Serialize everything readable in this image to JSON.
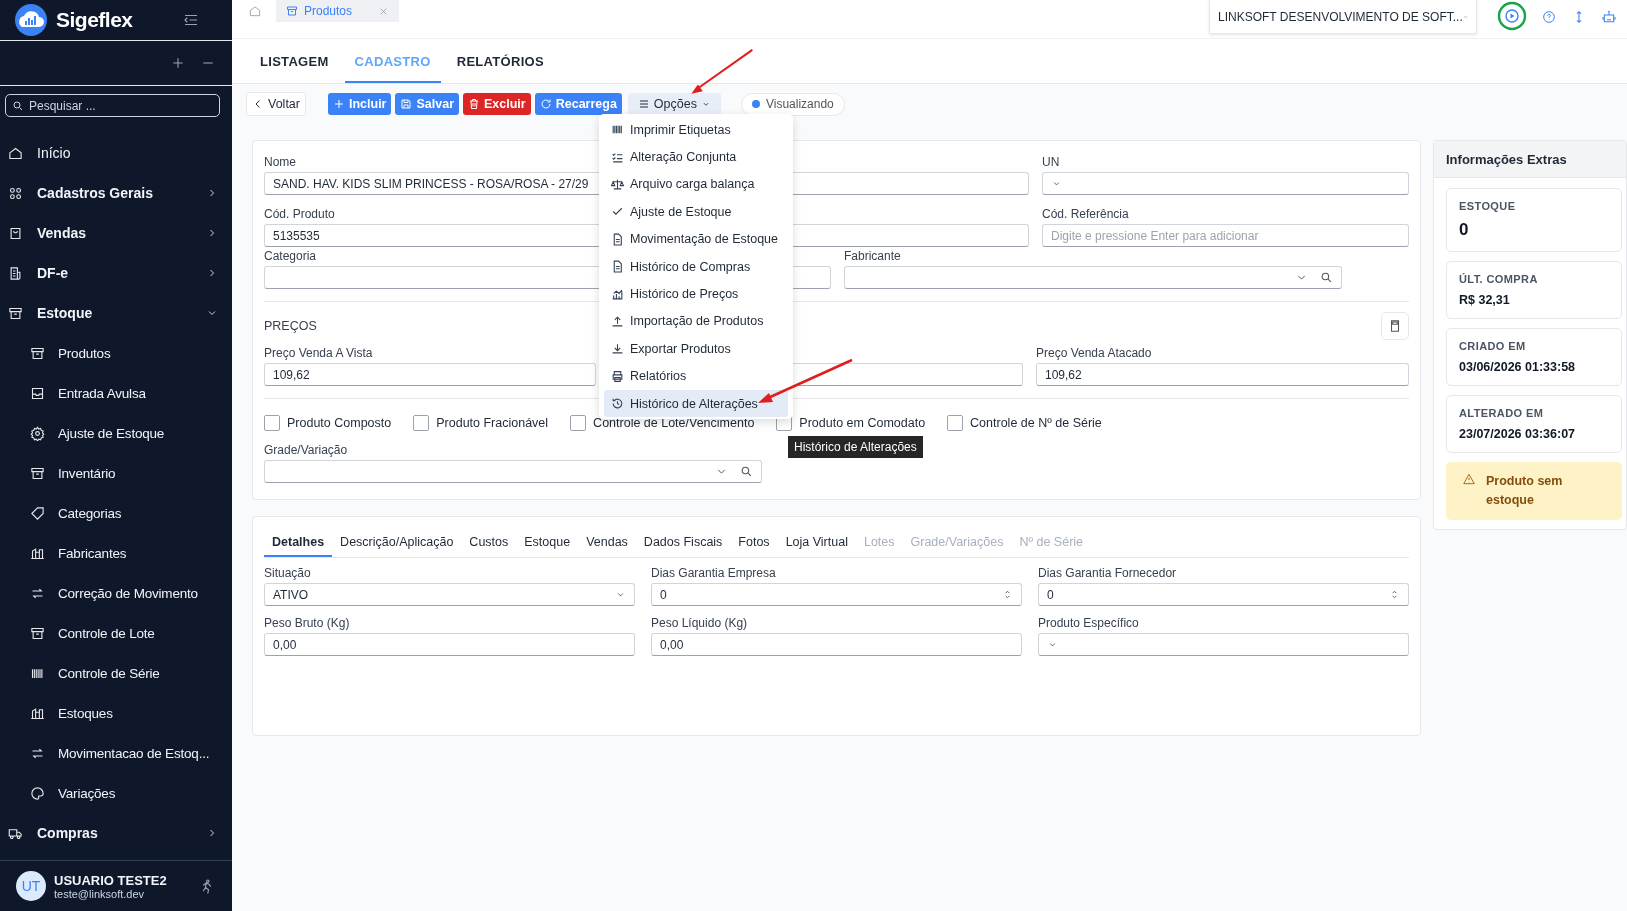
{
  "sidebar": {
    "brand": "Sigeflex",
    "search": {
      "placeholder": "Pesquisar ..."
    },
    "items": [
      {
        "label": "Início"
      },
      {
        "label": "Cadastros Gerais",
        "expanded": false
      },
      {
        "label": "Vendas",
        "expanded": false
      },
      {
        "label": "DF-e",
        "expanded": false
      },
      {
        "label": "Estoque",
        "expanded": true,
        "children": [
          {
            "label": "Produtos"
          },
          {
            "label": "Entrada Avulsa"
          },
          {
            "label": "Ajuste de Estoque"
          },
          {
            "label": "Inventário"
          },
          {
            "label": "Categorias"
          },
          {
            "label": "Fabricantes"
          },
          {
            "label": "Correção de Movimento"
          },
          {
            "label": "Controle de Lote"
          },
          {
            "label": "Controle de Série"
          },
          {
            "label": "Estoques"
          },
          {
            "label": "Movimentacao de Estoq..."
          },
          {
            "label": "Variações"
          }
        ]
      },
      {
        "label": "Compras",
        "expanded": false
      }
    ],
    "user": {
      "initials": "UT",
      "name": "USUARIO TESTE2",
      "email": "teste@linksoft.dev"
    }
  },
  "top_bar": {
    "tab": "Produtos",
    "company": "LINKSOFT DESENVOLVIMENTO DE SOFT..."
  },
  "page_tabs": [
    {
      "label": "LISTAGEM",
      "selected": false
    },
    {
      "label": "CADASTRO",
      "selected": true
    },
    {
      "label": "RELATÓRIOS",
      "selected": false
    }
  ],
  "toolbar": {
    "buttons": [
      {
        "label": "Voltar",
        "kind": "back"
      },
      {
        "label": "Incluir",
        "kind": "primary"
      },
      {
        "label": "Salvar",
        "kind": "primary"
      },
      {
        "label": "Excluir",
        "kind": "danger"
      },
      {
        "label": "Recarrega",
        "kind": "primary"
      },
      {
        "label": "Opções",
        "kind": "menu"
      }
    ],
    "status": "Visualizando"
  },
  "options_menu": [
    {
      "label": "Imprimir Etiquetas",
      "selected": false
    },
    {
      "label": "Alteração Conjunta",
      "selected": false
    },
    {
      "label": "Arquivo carga balança",
      "selected": false
    },
    {
      "label": "Ajuste de Estoque",
      "selected": false
    },
    {
      "label": "Movimentação de Estoque",
      "selected": false
    },
    {
      "label": "Histórico de Compras",
      "selected": false
    },
    {
      "label": "Histórico de Preços",
      "selected": false
    },
    {
      "label": "Importação de Produtos",
      "selected": false
    },
    {
      "label": "Exportar Produtos",
      "selected": false
    },
    {
      "label": "Relatórios",
      "selected": false
    },
    {
      "label": "Histórico de Alterações",
      "selected": true
    }
  ],
  "tooltip": "Histórico de Alterações",
  "form": {
    "rows": [
      [
        {
          "label": "Nome",
          "kind": "text",
          "value": "SAND. HAV. KIDS SLIM PRINCESS - ROSA/ROSA - 27/29"
        },
        {
          "label": "UN",
          "kind": "select"
        }
      ],
      [
        {
          "label": "Cód. Produto",
          "kind": "text",
          "value": "5135535"
        },
        {
          "label": "Cód. Referência",
          "kind": "text",
          "placeholder": "Digite e pressione Enter para adicionar"
        }
      ],
      [
        {
          "label": "Categoria",
          "kind": "text"
        },
        {
          "label": "Fabricante",
          "kind": "lookup"
        }
      ]
    ],
    "prices_title": "PREÇOS",
    "prices": [
      {
        "label": "Preço Venda A Vista",
        "kind": "text",
        "value": "109,62"
      },
      {
        "kind": "text"
      },
      {
        "label": "Preço Venda Atacado",
        "kind": "text",
        "value": "109,62"
      }
    ],
    "checkboxes": [
      {
        "label": "Produto Composto",
        "checked": false
      },
      {
        "label": "Produto Fracionável",
        "checked": false
      },
      {
        "label": "Controle de Lote/Vencimento",
        "checked": false
      },
      {
        "label": "Produto em Comodato",
        "checked": false
      },
      {
        "label": "Controle de Nº de Série",
        "checked": false
      }
    ],
    "variation": {
      "label": "Grade/Variação",
      "kind": "lookup"
    }
  },
  "details": {
    "tabs": [
      {
        "label": "Detalhes",
        "selected": true,
        "disabled": false
      },
      {
        "label": "Descrição/Aplicação",
        "selected": false,
        "disabled": false
      },
      {
        "label": "Custos",
        "selected": false,
        "disabled": false
      },
      {
        "label": "Estoque",
        "selected": false,
        "disabled": false
      },
      {
        "label": "Vendas",
        "selected": false,
        "disabled": false
      },
      {
        "label": "Dados Fiscais",
        "selected": false,
        "disabled": false
      },
      {
        "label": "Fotos",
        "selected": false,
        "disabled": false
      },
      {
        "label": "Loja Virtual",
        "selected": false,
        "disabled": false
      },
      {
        "label": "Lotes",
        "selected": false,
        "disabled": true
      },
      {
        "label": "Grade/Variações",
        "selected": false,
        "disabled": true
      },
      {
        "label": "Nº de Série",
        "selected": false,
        "disabled": true
      }
    ],
    "fields": [
      {
        "label": "Situação",
        "kind": "select",
        "value": "ATIVO"
      },
      {
        "label": "Dias Garantia Empresa",
        "kind": "number",
        "value": "0"
      },
      {
        "label": "Dias Garantia Fornecedor",
        "kind": "number",
        "value": "0"
      },
      {
        "label": "Peso Bruto (Kg)",
        "kind": "text",
        "value": "0,00"
      },
      {
        "label": "Peso Líquido (Kg)",
        "kind": "text",
        "value": "0,00"
      },
      {
        "label": "Produto Específico",
        "kind": "select"
      }
    ]
  },
  "extra_info": {
    "title": "Informações Extras",
    "cards": [
      {
        "label": "ESTOQUE",
        "value": "0",
        "kind": "big"
      },
      {
        "label": "ÚLT. COMPRA",
        "value": "R$ 32,31",
        "kind": "normal"
      },
      {
        "label": "CRIADO EM",
        "value": "03/06/2026 01:33:58",
        "kind": "normal"
      },
      {
        "label": "ALTERADO EM",
        "value": "23/07/2026 03:36:07",
        "kind": "normal"
      }
    ],
    "warning": "Produto sem estoque"
  }
}
